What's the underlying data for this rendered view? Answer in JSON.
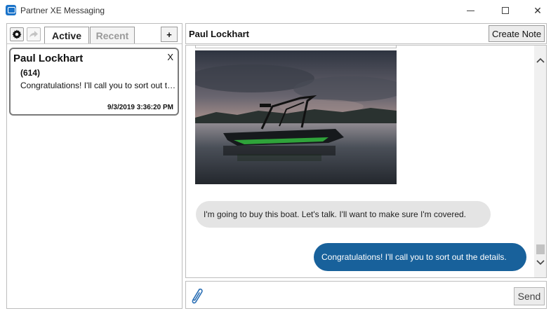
{
  "window": {
    "title": "Partner XE Messaging",
    "minimize_icon": "minimize-icon",
    "maximize_icon": "maximize-icon",
    "close_label": "✕"
  },
  "sidebar": {
    "tabs": [
      {
        "label": "Active",
        "selected": true
      },
      {
        "label": "Recent",
        "selected": false
      }
    ],
    "add_label": "+",
    "conversations": [
      {
        "name": "Paul Lockhart",
        "count": "(614)",
        "preview": "Congratulations! I'll call you to sort out the details.",
        "timestamp": "9/3/2019 3:36:20 PM",
        "close_label": "X"
      }
    ]
  },
  "conversation": {
    "contact_name": "Paul Lockhart",
    "create_note_label": "Create Note",
    "messages": [
      {
        "direction": "incoming",
        "type": "image",
        "alt": "boat"
      },
      {
        "direction": "incoming",
        "type": "text",
        "text": "I'm going to buy this boat. Let's talk. I'll want to make sure I'm covered."
      },
      {
        "direction": "outgoing",
        "type": "text",
        "text": "Congratulations! I'll call you to sort out the details."
      }
    ]
  },
  "compose": {
    "placeholder": "",
    "send_label": "Send"
  },
  "colors": {
    "outgoing_bubble": "#18619b",
    "incoming_bubble": "#e4e4e4",
    "app_icon": "#1a73c9"
  }
}
